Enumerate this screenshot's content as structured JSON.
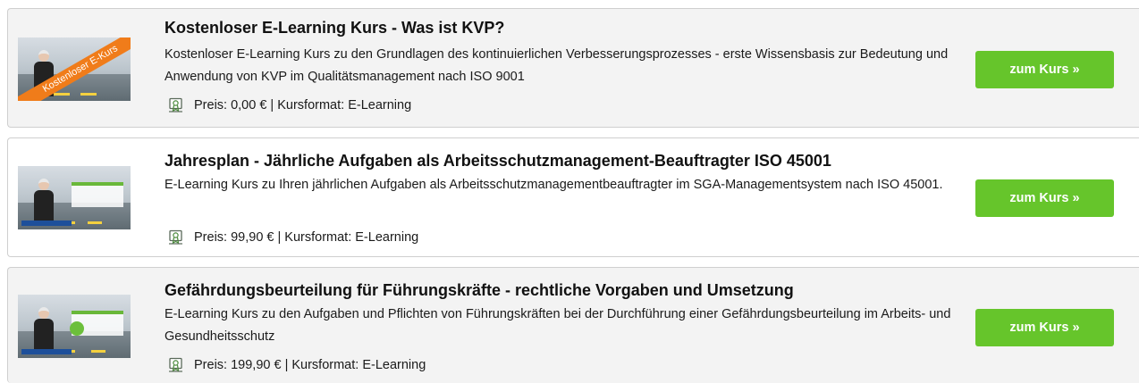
{
  "courses": [
    {
      "title": "Kostenloser E-Learning Kurs - Was ist KVP?",
      "description": "Kostenloser E-Learning Kurs zu den Grundlagen des kontinuierlichen Verbesserungsprozesses - erste Wissensbasis zur Bedeutung und Anwendung von KVP im Qualitätsmanagement nach ISO 9001",
      "meta": "Preis: 0,00 € | Kursformat: E-Learning",
      "badge": "Kostenloser E-Kurs",
      "button": "zum Kurs »"
    },
    {
      "title": "Jahresplan - Jährliche Aufgaben als Arbeitsschutzmanagement-Beauftragter ISO 45001",
      "description": "E-Learning Kurs zu Ihren jährlichen Aufgaben als Arbeitsschutzmanagementbeauftragter im SGA-Managementsystem nach ISO 45001.",
      "meta": "Preis: 99,90 € | Kursformat: E-Learning",
      "button": "zum Kurs »"
    },
    {
      "title": "Gefährdungsbeurteilung für Führungskräfte - rechtliche Vorgaben und Umsetzung",
      "description": "E-Learning Kurs zu den Aufgaben und Pflichten von Führungskräften bei der Durchführung einer Gefährdungsbeurteilung im Arbeits- und Gesundheitsschutz",
      "meta": "Preis: 199,90 € | Kursformat: E-Learning",
      "button": "zum Kurs »"
    }
  ],
  "icons": {
    "price": "certificate-icon"
  },
  "colors": {
    "button": "#66c52b",
    "badge": "#f07c1a",
    "card_alt": "#f3f3f3"
  }
}
